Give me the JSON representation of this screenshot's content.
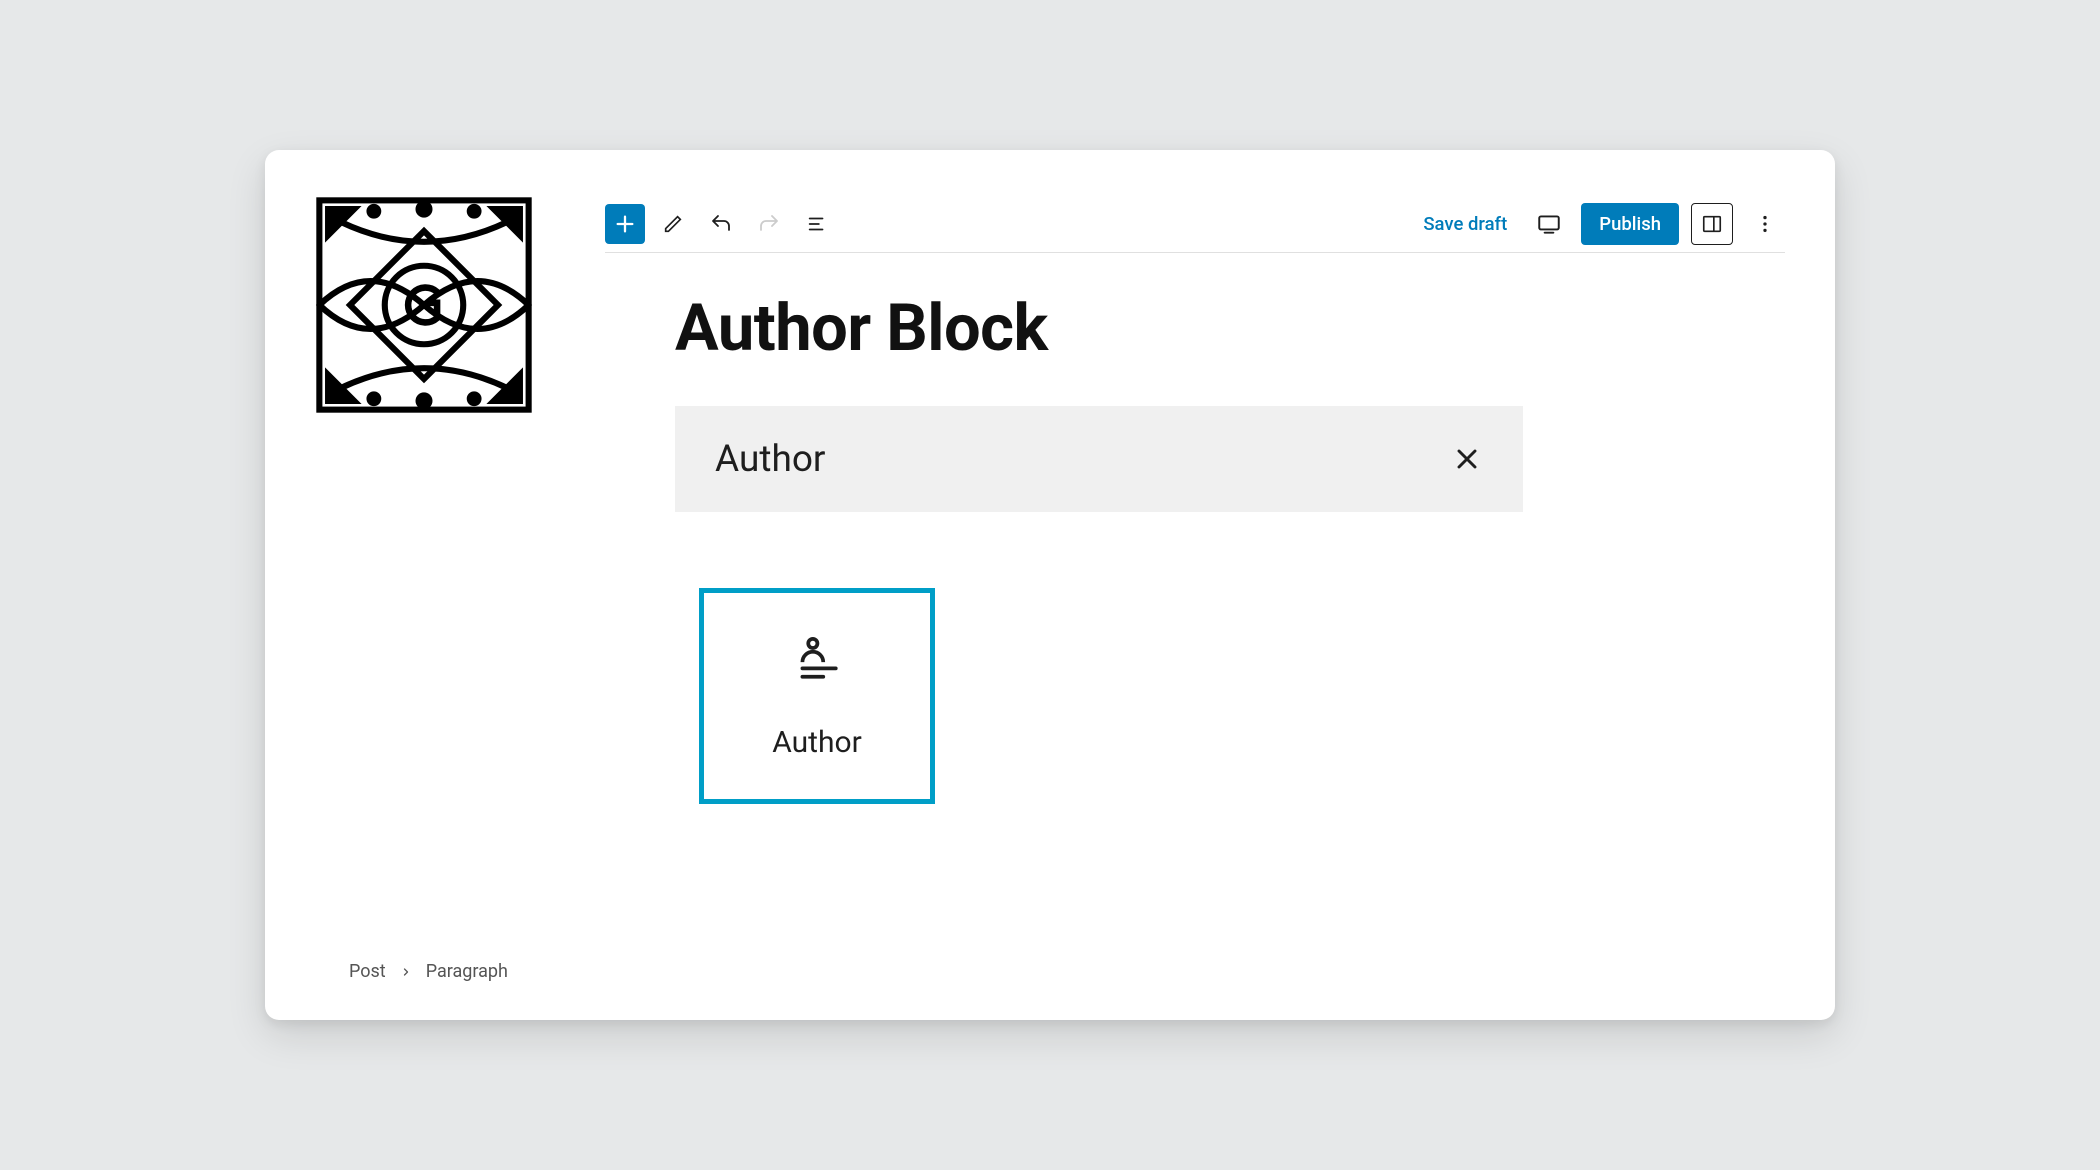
{
  "toolbar": {
    "save_draft_label": "Save draft",
    "publish_label": "Publish"
  },
  "page": {
    "title": "Author Block"
  },
  "search": {
    "query": "Author"
  },
  "result": {
    "label": "Author"
  },
  "breadcrumb": {
    "root": "Post",
    "current": "Paragraph"
  }
}
